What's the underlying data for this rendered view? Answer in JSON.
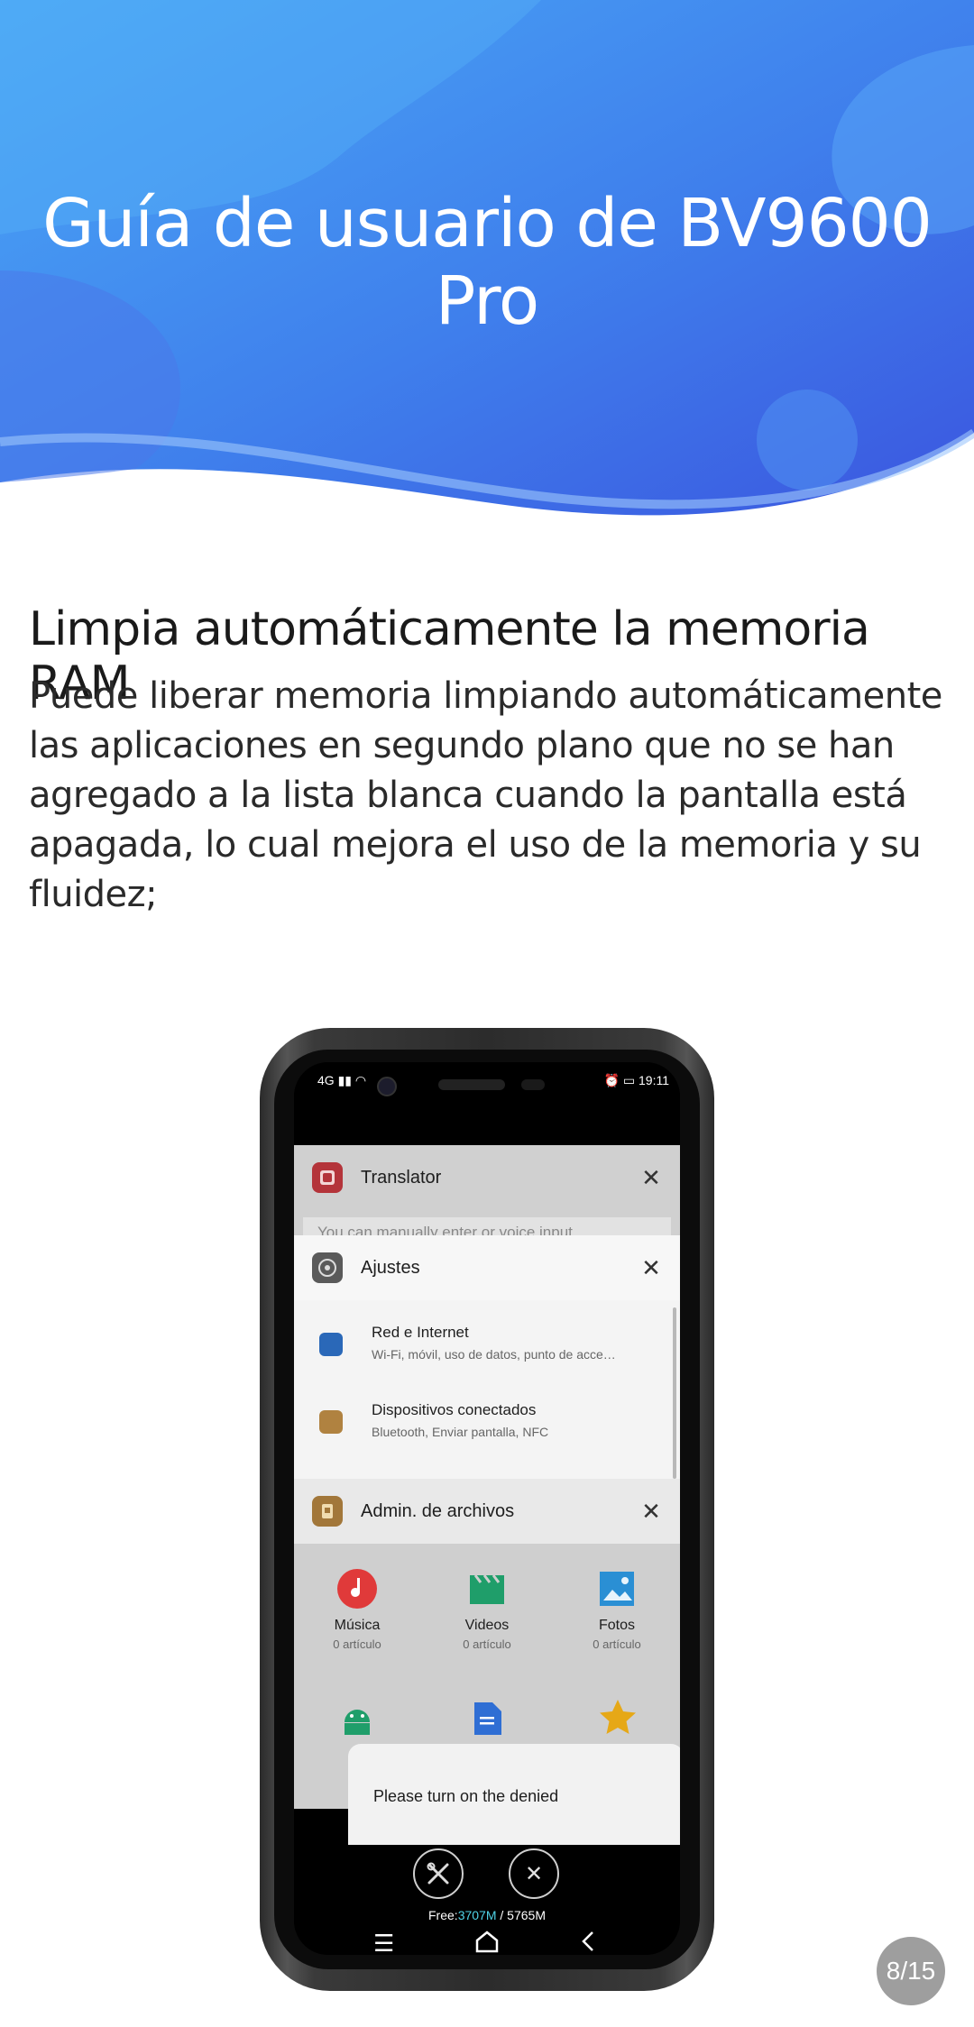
{
  "header": {
    "title": "Guía de usuario de BV9600 Pro"
  },
  "section": {
    "heading": "Limpia automáticamente la memoria RAM",
    "body": "Puede liberar memoria limpiando automáticamente las aplicaciones en segundo plano que no se han agregado a la lista blanca cuando la pantalla está apagada, lo cual mejora el uso de la memoria y su fluidez;"
  },
  "phone": {
    "status_left": "4G",
    "time": "19:11",
    "recents": {
      "translator": {
        "title": "Translator",
        "placeholder": "You can manually enter or voice input"
      },
      "ajustes": {
        "title": "Ajustes",
        "items": [
          {
            "title": "Red e Internet",
            "subtitle": "Wi-Fi, móvil, uso de datos, punto de acce…"
          },
          {
            "title": "Dispositivos conectados",
            "subtitle": "Bluetooth, Enviar pantalla, NFC"
          }
        ]
      },
      "files": {
        "title": "Admin. de archivos",
        "categories": [
          {
            "name": "Música",
            "count": "0 artículo"
          },
          {
            "name": "Videos",
            "count": "0 artículo"
          },
          {
            "name": "Fotos",
            "count": "0 artículo"
          }
        ],
        "dialog_text": "Please turn on the denied"
      }
    },
    "memory": {
      "label": "Free:",
      "free": "3707M",
      "separator": " / ",
      "total": "5765M"
    },
    "colors": {
      "banner_top": "#4aa2f5",
      "banner_bottom": "#3d5fe0",
      "mem_free": "#4fd4e8"
    }
  },
  "page_badge": "8/15"
}
